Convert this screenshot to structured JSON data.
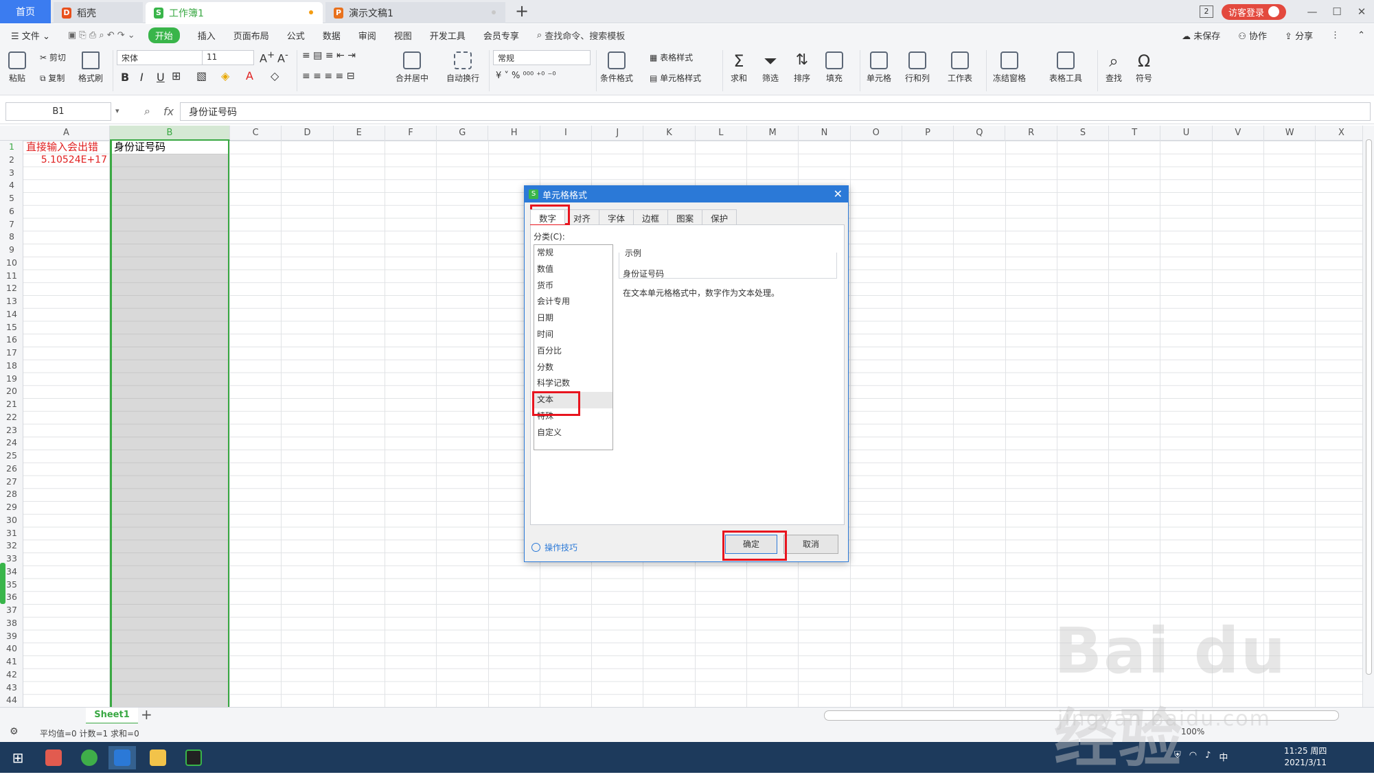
{
  "tabs": {
    "home": "首页",
    "daoke": "稻壳",
    "workbook": "工作簿1",
    "ppt": "演示文稿1"
  },
  "titlebar": {
    "badge": "2",
    "login": "访客登录",
    "min": "—",
    "max": "☐",
    "close": "✕"
  },
  "menu": {
    "file": "文件",
    "start": "开始",
    "insert": "插入",
    "page_layout": "页面布局",
    "formula": "公式",
    "data": "数据",
    "review": "审阅",
    "view": "视图",
    "dev": "开发工具",
    "member": "会员专享",
    "search": "查找命令、搜索模板",
    "unsaved": "未保存",
    "collab": "协作",
    "share": "分享"
  },
  "ribbon": {
    "paste": "粘贴",
    "cut": "剪切",
    "copy": "复制",
    "format_painter": "格式刷",
    "font_name": "宋体",
    "font_size": "11",
    "number_format": "常规",
    "merge_center": "合并居中",
    "wrap": "自动换行",
    "cond_format": "条件格式",
    "table_style": "表格样式",
    "cell_style": "单元格样式",
    "sum": "求和",
    "filter": "筛选",
    "sort": "排序",
    "fill": "填充",
    "cell": "单元格",
    "row_col": "行和列",
    "worksheet": "工作表",
    "freeze": "冻结窗格",
    "table_tools": "表格工具",
    "find": "查找",
    "symbol": "符号"
  },
  "formula_bar": {
    "name_box": "B1",
    "fx": "fx",
    "content": "身份证号码"
  },
  "sheet": {
    "columns": [
      "A",
      "B",
      "C",
      "D",
      "E",
      "F",
      "G",
      "H",
      "I",
      "J",
      "K",
      "L",
      "M",
      "N",
      "O",
      "P",
      "Q",
      "R",
      "S",
      "T",
      "U",
      "V",
      "W",
      "X"
    ],
    "rows": [
      "1",
      "2",
      "3",
      "4",
      "5",
      "6",
      "7",
      "8",
      "9",
      "10",
      "11",
      "12",
      "13",
      "14",
      "15",
      "16",
      "17",
      "18",
      "19",
      "20",
      "21",
      "22",
      "23",
      "24",
      "25",
      "26",
      "27",
      "28",
      "29",
      "30",
      "31",
      "32",
      "33",
      "34",
      "35",
      "36",
      "37",
      "38",
      "39",
      "40",
      "41",
      "42",
      "43",
      "44"
    ],
    "a1": "直接输入会出错",
    "a2": "5.10524E+17",
    "b1": "身份证号码"
  },
  "sheet_tab": {
    "name": "Sheet1",
    "add": "+"
  },
  "status": {
    "text": "平均值=0  计数=1  求和=0",
    "zoom": "100%"
  },
  "dialog": {
    "title": "单元格格式",
    "tabs": [
      "数字",
      "对齐",
      "字体",
      "边框",
      "图案",
      "保护"
    ],
    "category_label": "分类(C):",
    "categories": [
      "常规",
      "数值",
      "货币",
      "会计专用",
      "日期",
      "时间",
      "百分比",
      "分数",
      "科学记数",
      "文本",
      "特殊",
      "自定义"
    ],
    "sample_label": "示例",
    "sample_value": "身份证号码",
    "description": "在文本单元格格式中，数字作为文本处理。",
    "tips": "操作技巧",
    "ok": "确定",
    "cancel": "取消"
  },
  "taskbar": {
    "time": "11:25 周四",
    "date": "2021/3/11",
    "ime": "中"
  },
  "watermark": {
    "main": "Bai du 经验",
    "sub": "jingyan.baidu.com"
  }
}
